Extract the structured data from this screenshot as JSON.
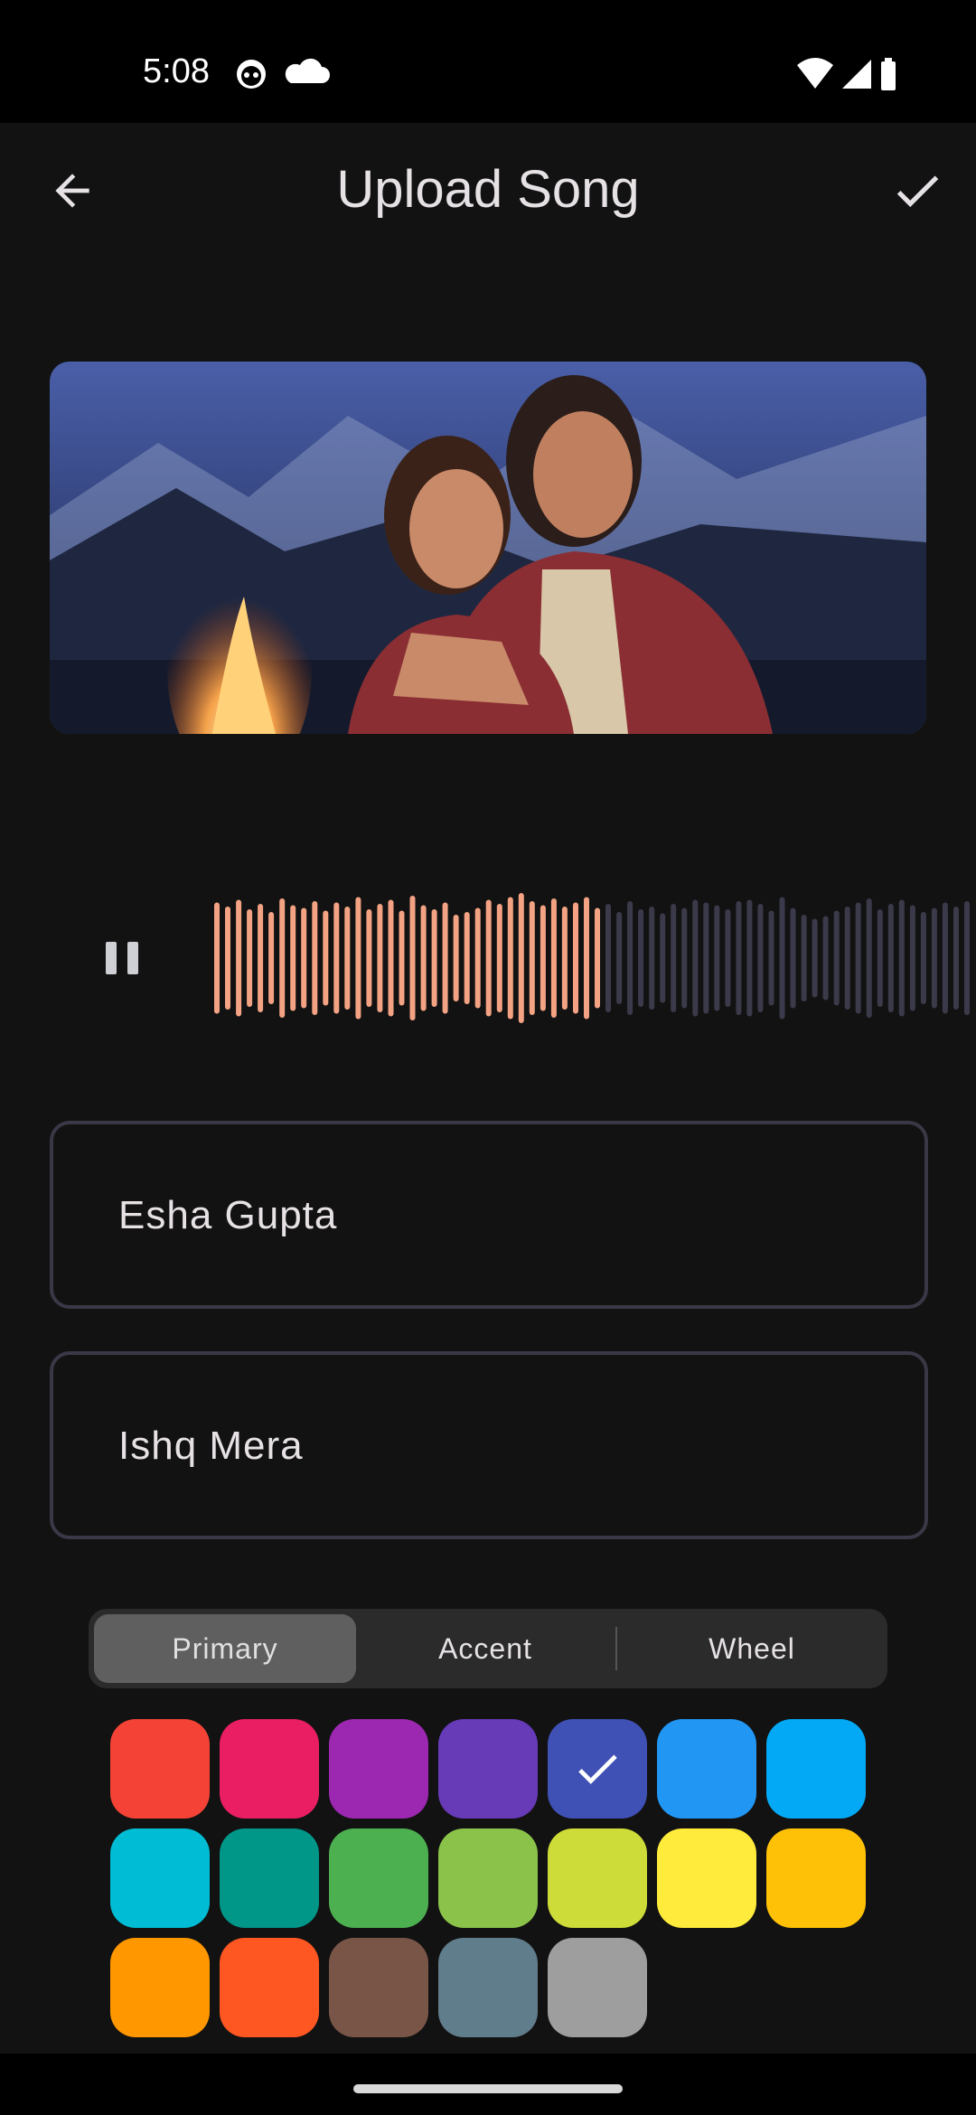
{
  "status_bar": {
    "time": "5:08",
    "left_icons": [
      "notification-bot-icon",
      "cloud-icon"
    ],
    "right_icons": [
      "wifi-icon",
      "cell-signal-icon",
      "battery-icon"
    ]
  },
  "app_bar": {
    "title": "Upload Song",
    "back_icon": "arrow-back-icon",
    "confirm_icon": "check-icon"
  },
  "cover_image": {
    "alt": "cover-photo",
    "colors": {
      "sky": "#3d4f8c",
      "mountain": "#222a44",
      "fire": "#f5a24a",
      "jacket": "#8a2e33",
      "skin": "#c98a6a"
    }
  },
  "player": {
    "state_icon": "pause-icon",
    "progress_fraction": 0.51,
    "played_color": "#f3a383",
    "unplayed_color": "#3b3a4a",
    "bar_levels": [
      0.82,
      0.76,
      0.86,
      0.72,
      0.8,
      0.68,
      0.88,
      0.78,
      0.74,
      0.84,
      0.7,
      0.82,
      0.76,
      0.9,
      0.72,
      0.8,
      0.86,
      0.7,
      0.92,
      0.78,
      0.72,
      0.82,
      0.64,
      0.68,
      0.74,
      0.86,
      0.8,
      0.9,
      0.96,
      0.84,
      0.78,
      0.88,
      0.76,
      0.82,
      0.9,
      0.74,
      0.8,
      0.68,
      0.84,
      0.72,
      0.76,
      0.66,
      0.8,
      0.74,
      0.86,
      0.82,
      0.78,
      0.72,
      0.84,
      0.86,
      0.8,
      0.7,
      0.9,
      0.74,
      0.64,
      0.58,
      0.62,
      0.7,
      0.76,
      0.82,
      0.88,
      0.72,
      0.8,
      0.86,
      0.78,
      0.68,
      0.74,
      0.82,
      0.76,
      0.84
    ]
  },
  "fields": {
    "artist": {
      "value": "Esha Gupta"
    },
    "song": {
      "value": "Ishq Mera"
    }
  },
  "color_picker": {
    "tabs": [
      {
        "label": "Primary",
        "active": true
      },
      {
        "label": "Accent",
        "active": false
      },
      {
        "label": "Wheel",
        "active": false
      }
    ],
    "swatches": [
      "#f44336",
      "#e91e63",
      "#9c27b0",
      "#673ab7",
      "#3f51b5",
      "#2196f3",
      "#03a9f4",
      "#00bcd4",
      "#009688",
      "#4caf50",
      "#8bc34a",
      "#cddc39",
      "#ffeb3b",
      "#ffc107",
      "#ff9800",
      "#ff5722",
      "#795548",
      "#607d8b",
      "#9e9e9e"
    ],
    "selected_index": 4,
    "selected_icon": "check-icon"
  }
}
